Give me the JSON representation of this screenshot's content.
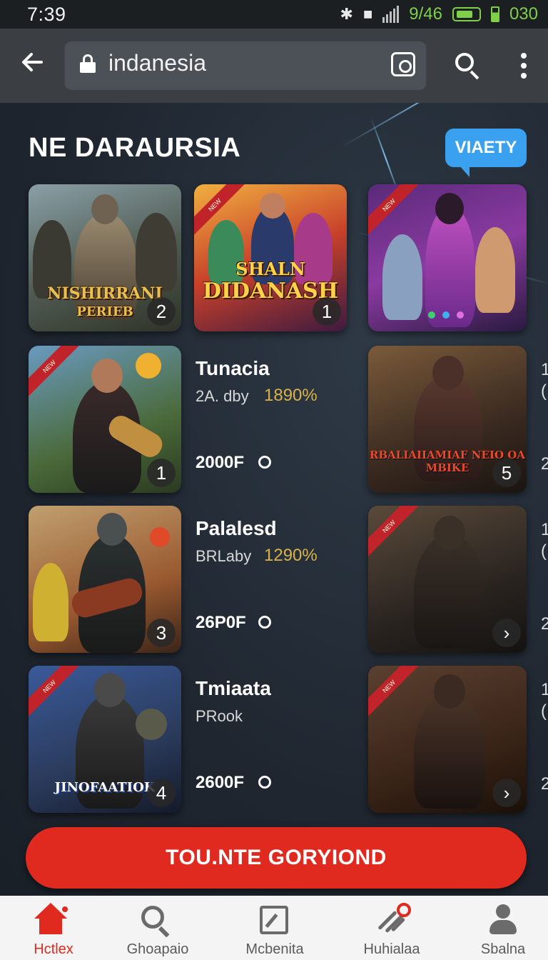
{
  "status_bar": {
    "time": "7:39",
    "bluetooth_icon": "bluetooth-icon",
    "signal_text": "9/46",
    "battery_text": "030"
  },
  "browser": {
    "url": "indanesia",
    "back_icon": "arrow-left-icon",
    "search_icon": "search-icon",
    "more_icon": "more-vertical-icon"
  },
  "header": {
    "title": "NE DARAURSIA",
    "badge": "VIAETY"
  },
  "tiles_top": [
    {
      "caption_1": "NISHIRRANI",
      "caption_2": "PERIEB",
      "number": "2"
    },
    {
      "caption_1": "SHALN",
      "caption_2": "DIDANASH",
      "number": "1"
    },
    {
      "caption_1": "",
      "caption_2": "",
      "number": ""
    }
  ],
  "games": [
    {
      "name": "Tunacia",
      "sub": "2A. dby",
      "percent": "1890%",
      "price": "2000F",
      "tile_number": "1",
      "right_caption": "RBALIAIIAMIAF NEIO OA MBIKE",
      "right_number": "5"
    },
    {
      "name": "Palalesd",
      "sub": "BRLaby",
      "percent": "1290%",
      "price": "26P0F",
      "tile_number": "3",
      "right_caption": "",
      "right_number": "›"
    },
    {
      "name": "Tmiaata",
      "sub": "PRook",
      "percent": "",
      "price": "2600F",
      "tile_number": "4",
      "left_caption": "JINOFAATIOK",
      "right_caption": "",
      "right_number": "›"
    }
  ],
  "edge_fragments": [
    "1",
    "(",
    "2",
    "1",
    "(",
    "2",
    "1",
    "(",
    "2"
  ],
  "cta": {
    "label": "TOU.NTE GORYIOND"
  },
  "bottom_nav": [
    {
      "label": "Hctlex",
      "icon": "home-icon",
      "active": true
    },
    {
      "label": "Ghoapaio",
      "icon": "search-icon",
      "active": false
    },
    {
      "label": "Mcbenita",
      "icon": "edit-icon",
      "active": false
    },
    {
      "label": "Huhialaa",
      "icon": "activity-icon",
      "active": false
    },
    {
      "label": "Sbalna",
      "icon": "user-icon",
      "active": false
    }
  ],
  "colors": {
    "accent": "#e02a1f",
    "badge": "#3aa0f0",
    "percent": "#d9b24a",
    "status_green": "#7fcf4a"
  }
}
